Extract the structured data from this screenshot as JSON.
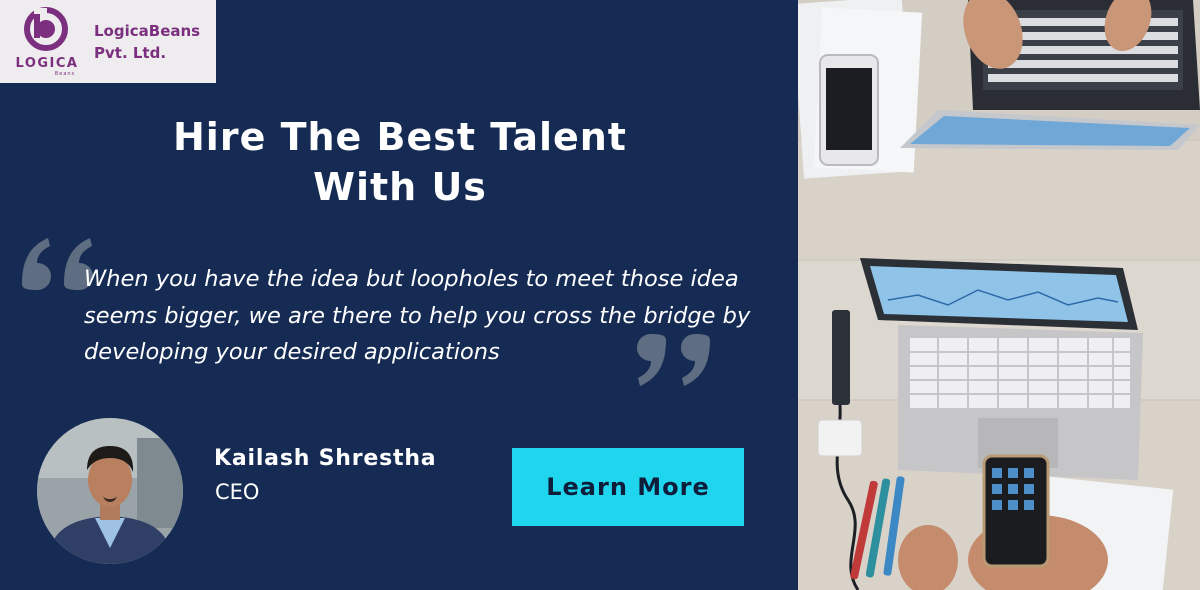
{
  "logo": {
    "mark_text": "LOGICA",
    "mark_subtext": "Beans",
    "company_line1": "LogicaBeans",
    "company_line2": "Pvt. Ltd."
  },
  "headline": {
    "line1": "Hire The Best Talent",
    "line2": "With Us"
  },
  "quote": {
    "text": "When you have the idea but loopholes to meet those idea seems bigger, we are there to help you cross the bridge by developing your desired applications"
  },
  "person": {
    "name": "Kailash Shrestha",
    "role": "CEO"
  },
  "cta": {
    "label": "Learn More"
  },
  "colors": {
    "background_navy": "#152b54",
    "accent_cyan": "#1fd6ee",
    "brand_purple": "#7b2f7e",
    "quote_mark_gray": "#5f6d82",
    "logo_bg": "#eeecef"
  },
  "icons": {
    "logo": "logicabeans-logo-icon",
    "open_quote": "open-quote-icon",
    "close_quote": "close-quote-icon"
  }
}
